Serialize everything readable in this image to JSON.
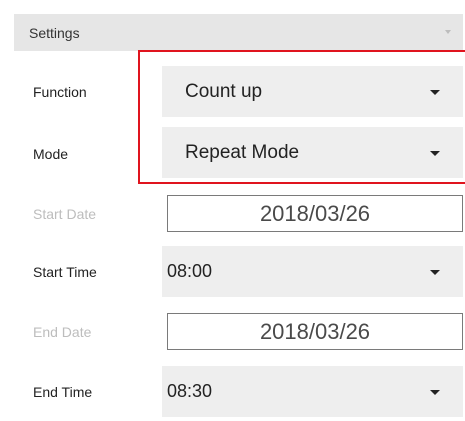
{
  "settings": {
    "title": "Settings"
  },
  "rows": {
    "function": {
      "label": "Function",
      "value": "Count up"
    },
    "mode": {
      "label": "Mode",
      "value": "Repeat Mode"
    },
    "start_date": {
      "label": "Start Date",
      "value": "2018/03/26"
    },
    "start_time": {
      "label": "Start Time",
      "value": "08:00"
    },
    "end_date": {
      "label": "End Date",
      "value": "2018/03/26"
    },
    "end_time": {
      "label": "End Time",
      "value": "08:30"
    }
  },
  "icons": {
    "dropdown": "chevron-down-icon"
  },
  "colors": {
    "highlight": "#e0141e",
    "disabled_label": "#bdbdbd",
    "control_bg": "#eeeeee",
    "header_bg": "#e6e6e6"
  }
}
